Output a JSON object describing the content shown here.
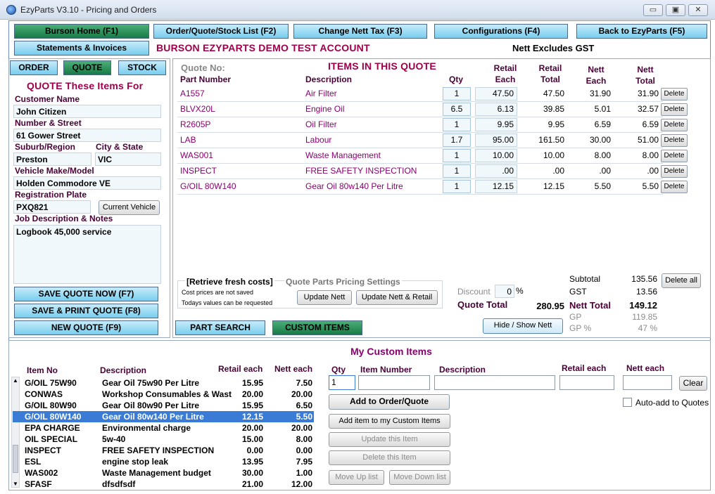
{
  "window": {
    "title": "EzyParts V3.10 - Pricing and Orders",
    "minimize": "▭",
    "restore": "▣",
    "close": "✕"
  },
  "nav": {
    "burson_home": "Burson Home (F1)",
    "order_list": "Order/Quote/Stock List (F2)",
    "change_tax": "Change Nett Tax (F3)",
    "configurations": "Configurations (F4)",
    "back": "Back to EzyParts (F5)",
    "statements": "Statements & Invoices",
    "account": "BURSON EZYPARTS DEMO TEST ACCOUNT",
    "gst_note": "Nett Excludes GST"
  },
  "tabs": {
    "order": "ORDER",
    "quote": "QUOTE",
    "stock": "STOCK"
  },
  "customer": {
    "heading": "QUOTE These Items For",
    "name_label": "Customer Name",
    "name": "John Citizen",
    "street_label": "Number & Street",
    "street": "61 Gower Street",
    "suburb_label": "Suburb/Region",
    "suburb": "Preston",
    "city_label": "City & State",
    "city": "VIC",
    "vehicle_label": "Vehicle Make/Model",
    "vehicle": "Holden Commodore VE",
    "rego_label": "Registration Plate",
    "rego": "PXQ821",
    "current_vehicle": "Current Vehicle",
    "notes_label": "Job Description & Notes",
    "notes": "Logbook 45,000 service"
  },
  "actions": {
    "save": "SAVE QUOTE NOW (F7)",
    "save_print": "SAVE & PRINT QUOTE (F8)",
    "new": "NEW QUOTE (F9)"
  },
  "quote": {
    "quote_no_label": "Quote No:",
    "heading": "ITEMS IN THIS QUOTE",
    "headers": {
      "part": "Part Number",
      "desc": "Description",
      "qty": "Qty",
      "retail_each_1": "Retail",
      "retail_each_2": "Each",
      "retail_total_1": "Retail",
      "retail_total_2": "Total",
      "nett_each_1": "Nett",
      "nett_each_2": "Each",
      "nett_total_1": "Nett",
      "nett_total_2": "Total"
    },
    "delete": "Delete",
    "items": [
      {
        "part": "A1557",
        "desc": "Air Filter",
        "qty": "1",
        "retail_each": "47.50",
        "retail_total": "47.50",
        "nett_each": "31.90",
        "nett_total": "31.90"
      },
      {
        "part": "BLVX20L",
        "desc": "Engine Oil",
        "qty": "6.5",
        "retail_each": "6.13",
        "retail_total": "39.85",
        "nett_each": "5.01",
        "nett_total": "32.57"
      },
      {
        "part": "R2605P",
        "desc": "Oil Filter",
        "qty": "1",
        "retail_each": "9.95",
        "retail_total": "9.95",
        "nett_each": "6.59",
        "nett_total": "6.59"
      },
      {
        "part": "LAB",
        "desc": "Labour",
        "qty": "1.7",
        "retail_each": "95.00",
        "retail_total": "161.50",
        "nett_each": "30.00",
        "nett_total": "51.00"
      },
      {
        "part": "WAS001",
        "desc": "Waste Management",
        "qty": "1",
        "retail_each": "10.00",
        "retail_total": "10.00",
        "nett_each": "8.00",
        "nett_total": "8.00"
      },
      {
        "part": "INSPECT",
        "desc": "FREE SAFETY INSPECTION",
        "qty": "1",
        "retail_each": ".00",
        "retail_total": ".00",
        "nett_each": ".00",
        "nett_total": ".00"
      },
      {
        "part": "G/OIL 80W140",
        "desc": "Gear Oil 80w140 Per Litre",
        "qty": "1",
        "retail_each": "12.15",
        "retail_total": "12.15",
        "nett_each": "5.50",
        "nett_total": "5.50"
      }
    ],
    "retrieve": "[Retrieve fresh costs]",
    "pricing_settings": "Quote Parts Pricing Settings",
    "cost_note_1": "Cost prices are not saved",
    "cost_note_2": "Todays values can be requested",
    "update_nett": "Update Nett",
    "update_nett_retail": "Update Nett & Retail",
    "discount_label": "Discount",
    "discount": "0",
    "percent": "%",
    "quote_total_label": "Quote Total",
    "quote_total": "280.95",
    "subtotal_label": "Subtotal",
    "subtotal": "135.56",
    "gst_label": "GST",
    "gst": "13.56",
    "nett_total_label": "Nett Total",
    "nett_total": "149.12",
    "gp_label": "GP",
    "gp": "119.85",
    "gp_pct_label": "GP %",
    "gp_pct": "47 %",
    "delete_all": "Delete all",
    "hide_show": "Hide / Show Nett"
  },
  "part_search": "PART SEARCH",
  "custom_items_tab": "CUSTOM ITEMS",
  "custom": {
    "heading": "My Custom Items",
    "headers": {
      "item": "Item No",
      "desc": "Description",
      "retail": "Retail each",
      "nett": "Nett each"
    },
    "items": [
      {
        "item": "G/OIL 75W90",
        "desc": "Gear Oil 75w90 Per Litre",
        "retail": "15.95",
        "nett": "7.50"
      },
      {
        "item": "CONWAS",
        "desc": "Workshop Consumables & Wast",
        "retail": "20.00",
        "nett": "20.00"
      },
      {
        "item": "G/OIL 80W90",
        "desc": "Gear Oil 80w90 Per Litre",
        "retail": "15.95",
        "nett": "6.50"
      },
      {
        "item": "G/OIL 80W140",
        "desc": "Gear Oil 80w140 Per Litre",
        "retail": "12.15",
        "nett": "5.50"
      },
      {
        "item": "EPA CHARGE",
        "desc": "Environmental charge",
        "retail": "20.00",
        "nett": "20.00"
      },
      {
        "item": "OIL SPECIAL",
        "desc": "5w-40",
        "retail": "15.00",
        "nett": "8.00"
      },
      {
        "item": "INSPECT",
        "desc": "FREE SAFETY INSPECTION",
        "retail": "0.00",
        "nett": "0.00"
      },
      {
        "item": "ESL",
        "desc": "engine stop leak",
        "retail": "13.95",
        "nett": "7.95"
      },
      {
        "item": "WAS002",
        "desc": "Waste Management budget",
        "retail": "30.00",
        "nett": "1.00"
      },
      {
        "item": "SFASF",
        "desc": "dfsdfsdf",
        "retail": "21.00",
        "nett": "12.00"
      }
    ],
    "form": {
      "qty_label": "Qty",
      "qty": "1",
      "item_label": "Item Number",
      "desc_label": "Description",
      "retail_label": "Retail each",
      "nett_label": "Nett each",
      "clear": "Clear"
    },
    "add_order": "Add to Order/Quote",
    "add_custom": "Add item to my Custom Items",
    "update": "Update this Item",
    "delete": "Delete this Item",
    "move_up": "Move Up list",
    "move_down": "Move Down list",
    "auto_add": "Auto-add to Quotes"
  }
}
